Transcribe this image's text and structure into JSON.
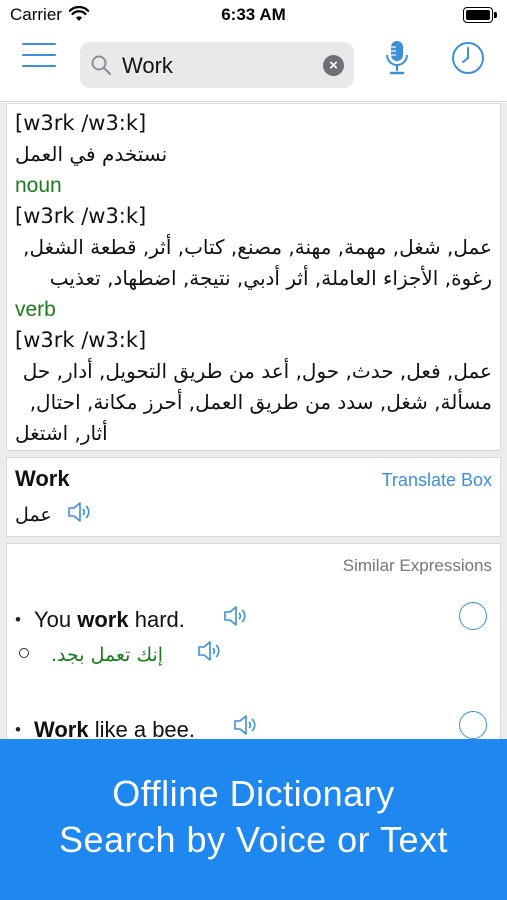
{
  "status_bar": {
    "carrier": "Carrier",
    "time": "6:33 AM"
  },
  "search": {
    "query": "Work"
  },
  "definition": {
    "lines": [
      {
        "type": "pron",
        "text": "[w3rk /w3:k]"
      },
      {
        "type": "ar",
        "text": "نستخدم في العمل"
      },
      {
        "type": "pos",
        "text": "noun"
      },
      {
        "type": "pron",
        "text": "[w3rk /w3:k]"
      },
      {
        "type": "ar",
        "text": "عمل, شغل, مهمة, مهنة, مصنع, كتاب, أثر, قطعة الشغل,"
      },
      {
        "type": "ar",
        "text": "رغوة, الأجزاء العاملة, أثر أدبي, نتيجة, اضطهاد, تعذيب"
      },
      {
        "type": "pos",
        "text": "verb"
      },
      {
        "type": "pron",
        "text": "[w3rk /w3:k]"
      },
      {
        "type": "ar",
        "text": "عمل, فعل, حدث, حول, أعد من طريق التحويل, أدار, حل"
      },
      {
        "type": "ar",
        "text": "مسألة, شغل, سدد من طريق العمل, أحرز مكانة, احتال,"
      },
      {
        "type": "ar",
        "text": "أثار, اشتغل"
      }
    ]
  },
  "translate_box": {
    "word": "Work",
    "link": "Translate Box",
    "arabic": "عمل"
  },
  "expressions": {
    "header": "Similar Expressions",
    "items": [
      {
        "pre": "You ",
        "bold": "work",
        "post": " hard.",
        "arabic": ".إنك تعمل بجد"
      },
      {
        "pre": "",
        "bold": "Work",
        "post": " like a bee.",
        "arabic": ""
      }
    ]
  },
  "promo": {
    "line1": "Offline Dictionary",
    "line2": "Search by Voice or Text"
  },
  "colors": {
    "accent": "#3d8fd8",
    "pos_green": "#1d7a1d",
    "banner": "#1f87f0"
  },
  "icons": [
    "wifi-icon",
    "battery-icon",
    "menu-icon",
    "search-icon",
    "clear-icon",
    "microphone-icon",
    "history-clock-icon",
    "speaker-icon",
    "radio-icon"
  ]
}
